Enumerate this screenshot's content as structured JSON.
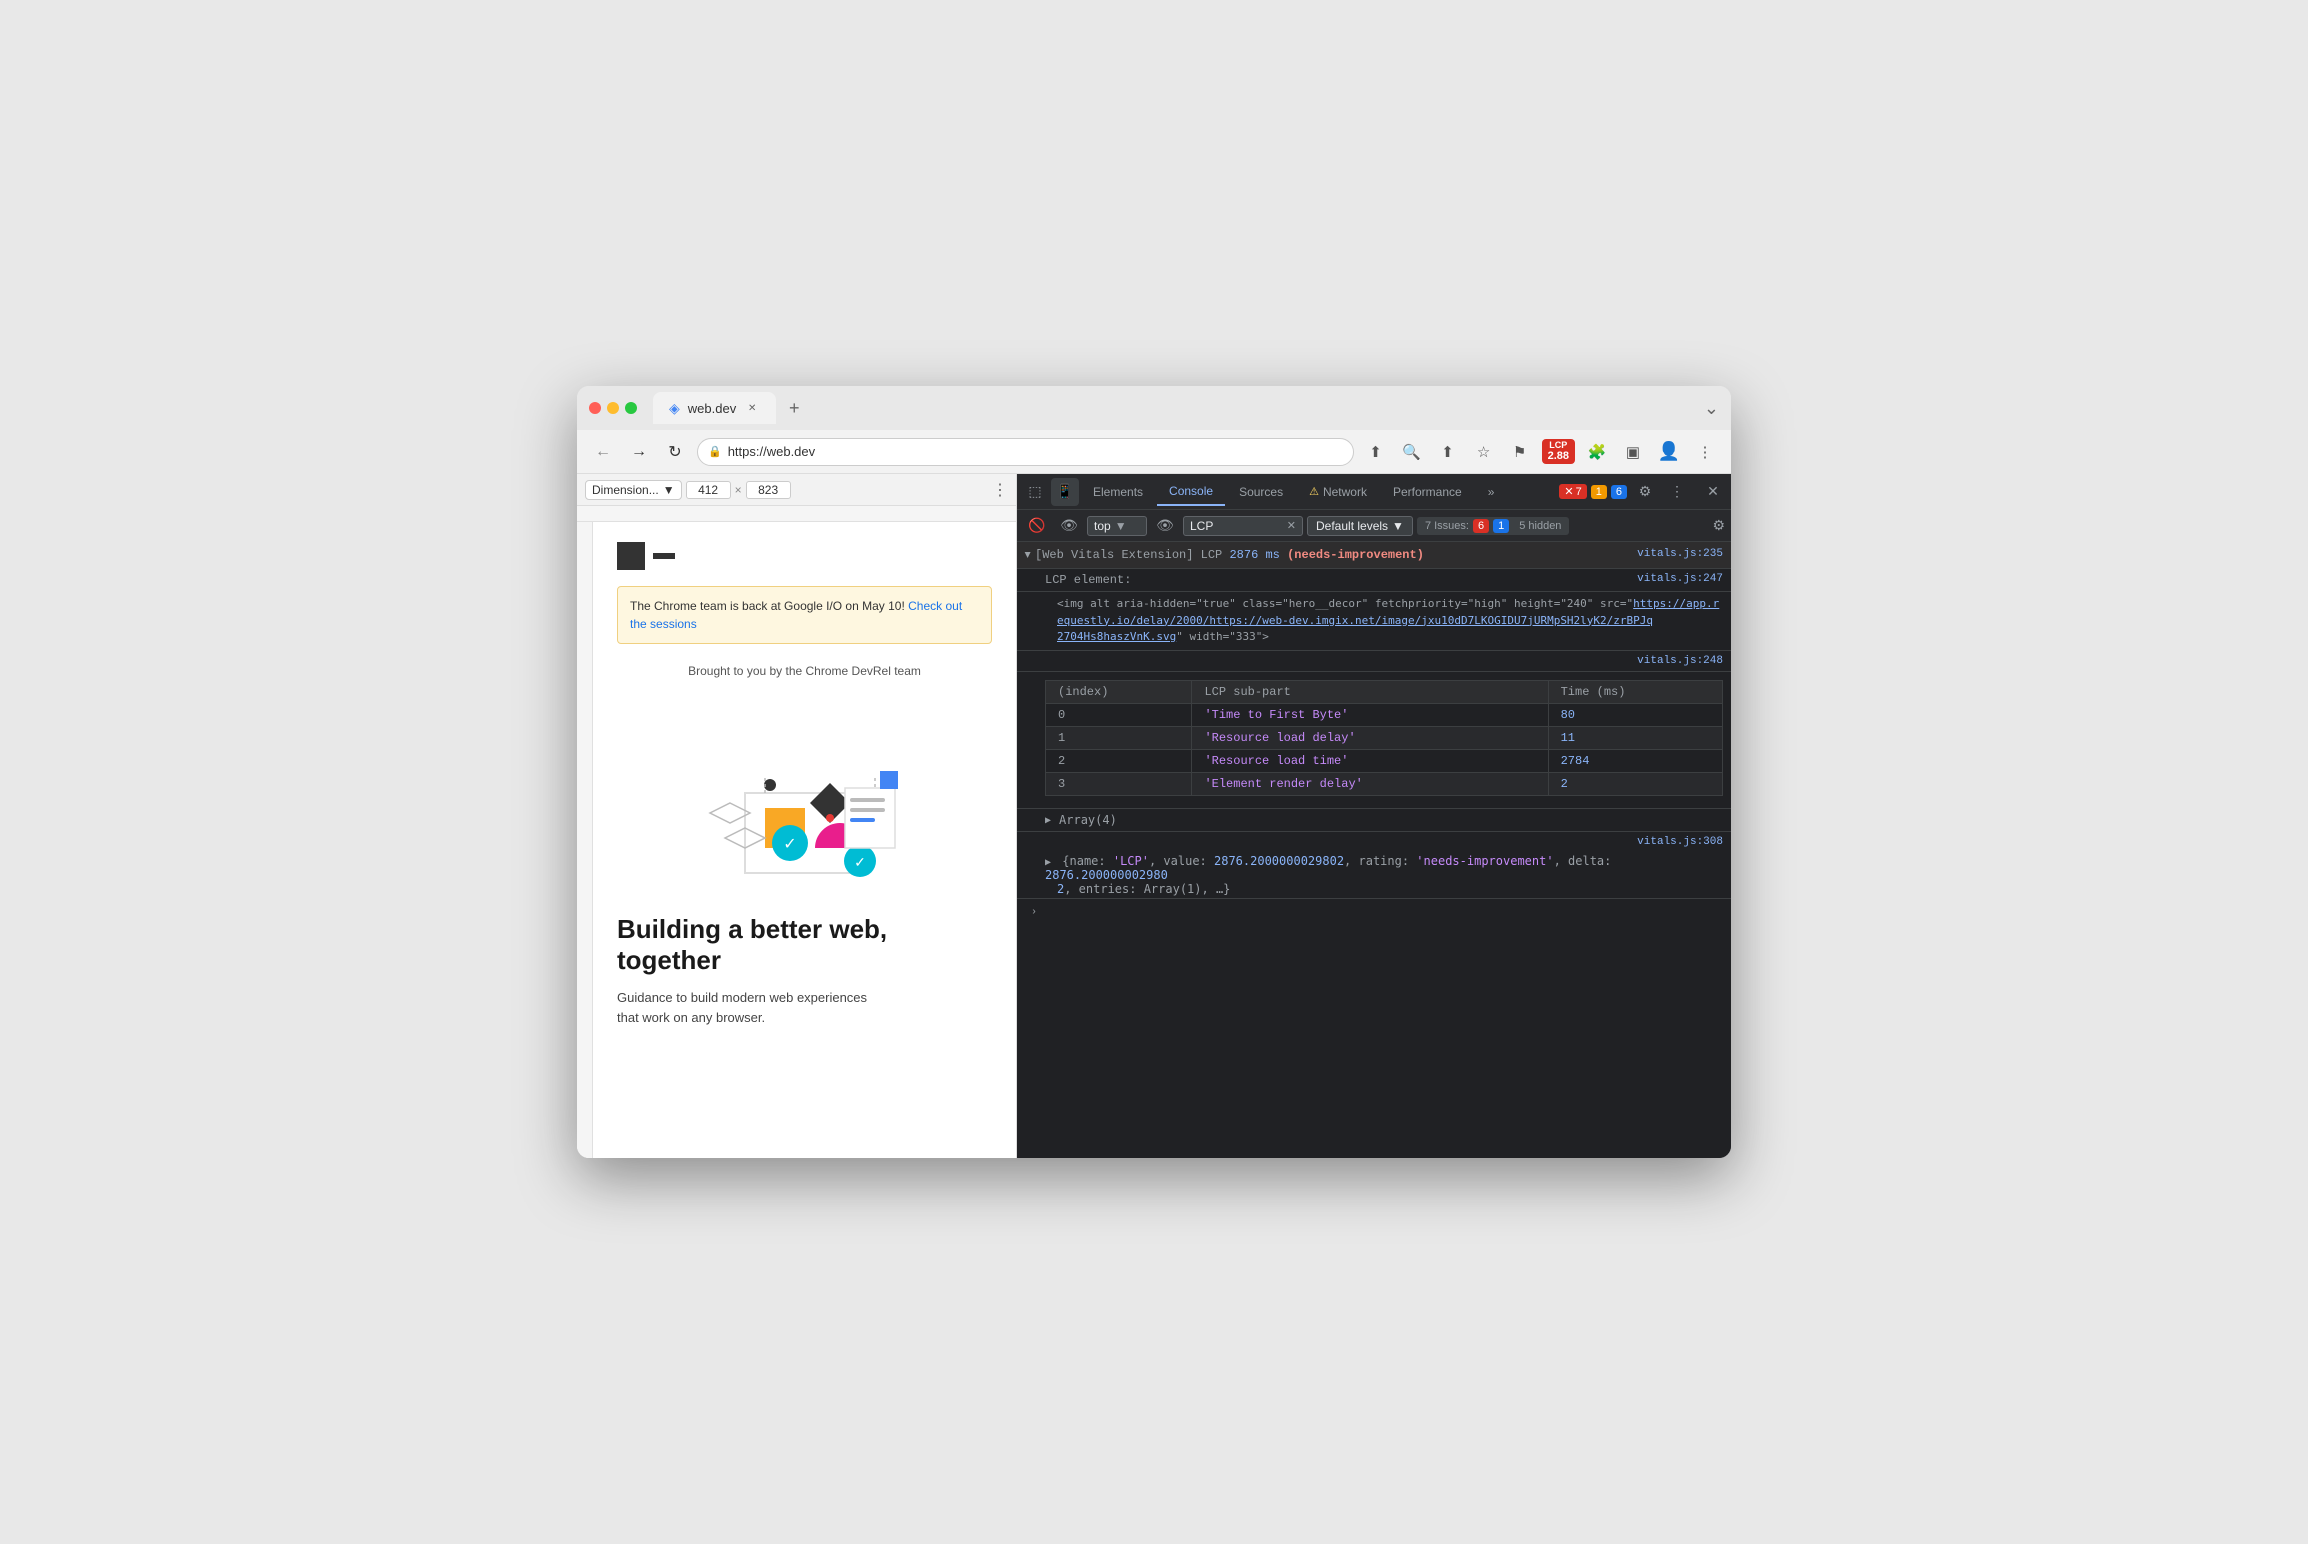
{
  "browser": {
    "traffic_lights": [
      "red",
      "yellow",
      "green"
    ],
    "tab_title": "web.dev",
    "tab_favicon": "◈",
    "new_tab_label": "+",
    "chevron_label": "⌄",
    "back_label": "←",
    "forward_label": "→",
    "refresh_label": "↻",
    "address_url": "https://web.dev",
    "address_icon": "🔒",
    "toolbar_icons": [
      "⬆",
      "🔍",
      "⬆",
      "☆",
      "⚑"
    ],
    "lcp_label": "LCP",
    "lcp_value": "2.88",
    "puzzle_icon": "🧩",
    "profile_icon": "👤",
    "menu_icon": "⋮",
    "sidebar_icon": "▣"
  },
  "dimension_bar": {
    "selector_label": "Dimension...",
    "chevron": "▼",
    "width_value": "412",
    "height_value": "823",
    "sep_label": "×",
    "more_label": "⋮"
  },
  "webpage": {
    "notification_text": "The Chrome team is back at Google I/O on May 10! ",
    "notification_link": "Check out the sessions",
    "devrel_text": "Brought to you by the Chrome DevRel team",
    "hero_title": "Building a better web,\ntogether",
    "hero_desc": "Guidance to build modern web experiences\nthat work on any browser."
  },
  "devtools": {
    "tabs": [
      "Elements",
      "Console",
      "Sources",
      "Network",
      "Performance"
    ],
    "active_tab": "Console",
    "more_tabs_label": "»",
    "error_count": "7",
    "warning_count": "1",
    "info_count": "6",
    "settings_icon": "⚙",
    "more_icon": "⋮",
    "close_icon": "✕",
    "inspect_icon": "⬚",
    "device_icon": "📱",
    "console_toolbar": {
      "ban_icon": "🚫",
      "filter_placeholder": "LCP",
      "filter_clear": "✕",
      "level_label": "Default levels",
      "level_chevron": "▼",
      "issues_label": "7 Issues:",
      "error_badge": "6",
      "info_badge": "1",
      "hidden_label": "5 hidden",
      "gear_icon": "⚙"
    },
    "console_rows": [
      {
        "type": "vitals-header",
        "expand": true,
        "text": "[Web Vitals Extension] LCP ",
        "value": "2876 ms",
        "status": "(needs-improvement)",
        "source": "vitals.js:235"
      },
      {
        "type": "element-label",
        "text": "LCP element:",
        "source": "vitals.js:247"
      },
      {
        "type": "element-html",
        "html": "<img alt aria-hidden=\"true\" class=\"hero__decor\" fetchpriority=\"high\" height=\"240\" src=\"",
        "link": "https://app.requestly.io/delay/2000/https://web-dev.imgix.net/image/jxu10dD7LKOGIDU7jURMpSH2lyK2/zrBPJq2704Hs8haszVnK.svg",
        "link_end": "\" width=\"333\">"
      },
      {
        "type": "table-source",
        "source": "vitals.js:248"
      },
      {
        "type": "table",
        "headers": [
          "(index)",
          "LCP sub-part",
          "Time (ms)"
        ],
        "rows": [
          {
            "index": "0",
            "sub_part": "'Time to First Byte'",
            "time": "80"
          },
          {
            "index": "1",
            "sub_part": "'Resource load delay'",
            "time": "11"
          },
          {
            "index": "2",
            "sub_part": "'Resource load time'",
            "time": "2784"
          },
          {
            "index": "3",
            "sub_part": "'Element render delay'",
            "time": "2"
          }
        ]
      },
      {
        "type": "array",
        "text": "▶ Array(4)"
      },
      {
        "type": "vitals-obj-source",
        "source": "vitals.js:308"
      },
      {
        "type": "vitals-object",
        "expand": false,
        "text": "{name: 'LCP', value: ",
        "value": "2876.2000000029802",
        "text2": ", rating: ",
        "rating": "'needs-improvement'",
        "text3": ", delta: ",
        "delta": "2876.200000002980",
        "text4": "\n2, entries: Array(1), …}"
      },
      {
        "type": "arrow",
        "text": "›"
      }
    ]
  }
}
